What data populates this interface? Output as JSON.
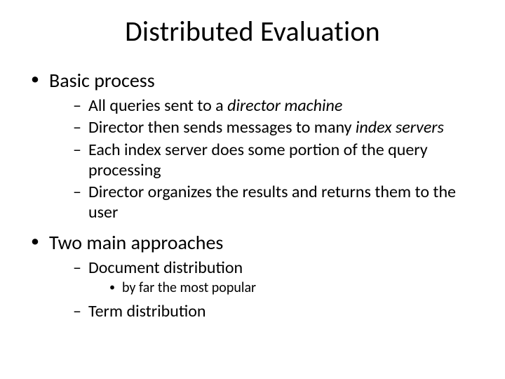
{
  "title": "Distributed Evaluation",
  "b1": {
    "label": "Basic process",
    "sub": {
      "s1a": "All queries sent to a ",
      "s1b": "director machine",
      "s2a": "Director then sends messages to many ",
      "s2b": "index servers",
      "s3": "Each index server does some portion of the query processing",
      "s4": "Director organizes the results and returns them to the user"
    }
  },
  "b2": {
    "label": "Two main approaches",
    "sub": {
      "s1": "Document distribution",
      "s1_sub": "by far the most popular",
      "s2": "Term distribution"
    }
  }
}
